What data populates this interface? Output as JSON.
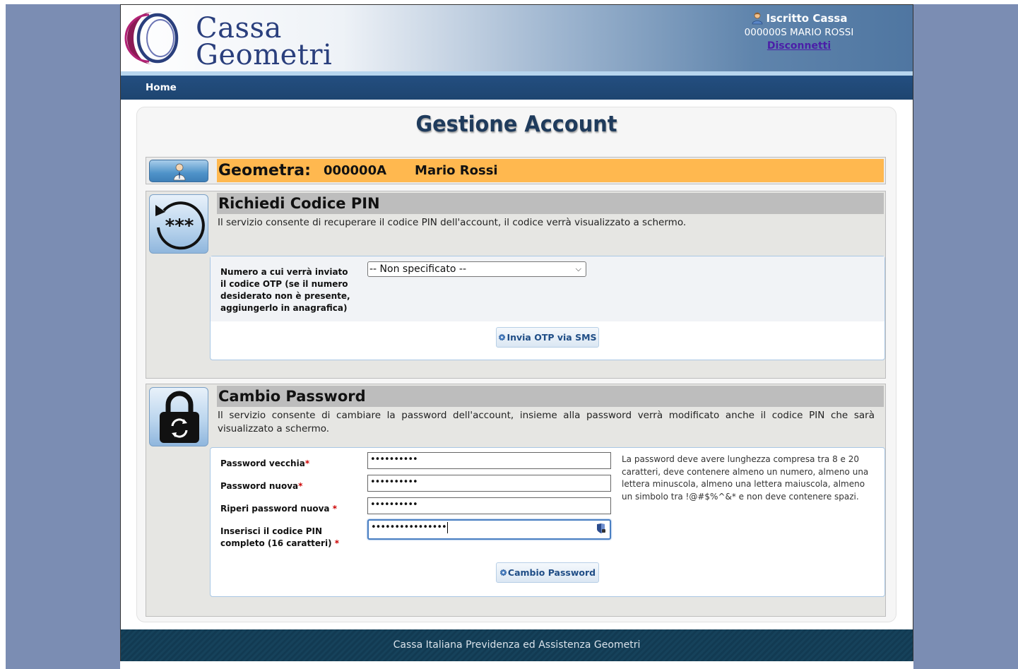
{
  "header": {
    "logo_line1": "Cassa",
    "logo_line2": "Geometri",
    "user_role": "Iscritto Cassa",
    "user_name": "000000S MARIO ROSSI",
    "logout_label": "Disconnetti"
  },
  "nav": {
    "home_label": "Home"
  },
  "page_title": "Gestione Account",
  "geometra": {
    "label": "Geometra:",
    "code": "000000A",
    "name": "Mario Rossi"
  },
  "pin_section": {
    "title": "Richiedi Codice PIN",
    "description": "Il servizio consente di recuperare il codice PIN dell'account, il codice verrà visualizzato a schermo.",
    "otp_label": "Numero a cui verrà inviato il codice OTP (se il numero desiderato non è presente, aggiungerlo in anagrafica)",
    "otp_select_value": "-- Non specificato --",
    "send_button": "Invia OTP via SMS"
  },
  "password_section": {
    "title": "Cambio Password",
    "description": "Il servizio consente di cambiare la password dell'account, insieme alla password verrà modificato anche il codice PIN che sarà visualizzato a schermo.",
    "old_password_label": "Password vecchia",
    "new_password_label": "Password nuova",
    "repeat_password_label": "Riperi password nuova ",
    "pin_label": "Inserisci il codice PIN completo (16 caratteri) ",
    "required_mark": "*",
    "old_password_value": "••••••••••",
    "new_password_value": "••••••••••",
    "repeat_password_value": "••••••••••",
    "pin_value": "••••••••••••••••",
    "rules_note": "La password deve avere lunghezza compresa tra 8 e 20 caratteri, deve contenere almeno un numero, almeno una lettera minuscola, almeno una lettera maiuscola, almeno un simbolo tra !@#$%^&* e non deve contenere spazi.",
    "submit_button": "Cambio Password"
  },
  "footer": {
    "text": "Cassa Italiana Previdenza ed Assistenza Geometri"
  },
  "colors": {
    "side_background": "#7b8db3",
    "nav_background": "#234e80",
    "geometra_bar": "#ffb84f",
    "section_header": "#bdbdbd",
    "footer_background": "#123a52",
    "title_color": "#1f3b5c",
    "required": "#cc0000"
  },
  "icons": {
    "user": "user-icon",
    "pin_reset": "pin-reset-icon",
    "lock_refresh": "lock-refresh-icon",
    "gear": "gear-icon",
    "password_manager": "password-manager-icon"
  }
}
